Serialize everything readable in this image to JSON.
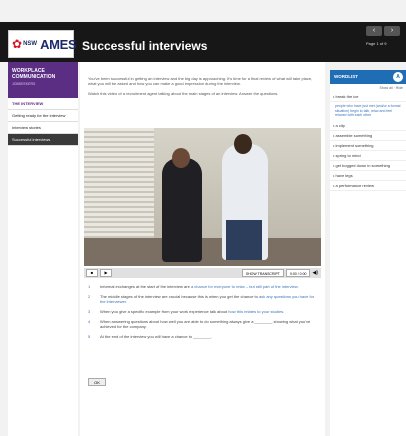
{
  "header": {
    "logo_nsw": "NSW",
    "logo_ames": "AMES",
    "title": "Successful interviews",
    "prev": "‹",
    "next": "›",
    "page_indicator": "Page 1 of 9"
  },
  "leftnav": {
    "heading": "WORKPLACE COMMUNICATION",
    "subheading": "JOBSEEKERS",
    "section": "THE INTERVIEW",
    "items": [
      {
        "label": "Getting ready for the interview"
      },
      {
        "label": "Interview stories"
      },
      {
        "label": "Successful interviews"
      }
    ]
  },
  "intro": {
    "p1": "You've been successful in getting an interview and the big day is approaching. It's time for a final review of what will take place, what you will be asked and how you can make a good impression during the interview.",
    "p2": "Watch this video of a recruitment agent talking about the main stages of an interview. Answer the questions."
  },
  "controls": {
    "play": "▶",
    "stop": "■",
    "show_transcript": "SHOW TRANSCRIPT",
    "time": "0:00 / 0:00",
    "volume": "◀)"
  },
  "questions": [
    {
      "num": "1",
      "text": "Informal exchanges at the start of the interview are ",
      "blue": "a chance for everyone to relax – but still part of the interview."
    },
    {
      "num": "2",
      "text": "The middle stages of the interview are crucial because this is when you get the chance to ",
      "blue": "ask any questions you have for the interviewer."
    },
    {
      "num": "3",
      "text": "When you give a specific example from your work experience talk about ",
      "blue": "how this relates to your studies."
    },
    {
      "num": "4",
      "text": "When answering questions about how well you are able to do something always give a ________ showing what you've achieved for the company.",
      "blue": ""
    },
    {
      "num": "5",
      "text": "At the end of the interview you will have a chance to ________.",
      "blue": ""
    }
  ],
  "ok_label": "OK",
  "wordlist": {
    "heading": "WORDLIST",
    "badge": "A",
    "show_all": "Show all · Hide",
    "items": [
      {
        "term": "• break the ice",
        "def": "people who have just met (and/or a formal situation) begin to talk, relax and feel relaxed with each other"
      },
      {
        "term": "• a clip",
        "def": ""
      },
      {
        "term": "• assemble something",
        "def": ""
      },
      {
        "term": "• implement something",
        "def": ""
      },
      {
        "term": "• spring to mind",
        "def": ""
      },
      {
        "term": "• get bogged down in something",
        "def": ""
      },
      {
        "term": "• have legs",
        "def": ""
      },
      {
        "term": "• a performance review",
        "def": ""
      }
    ]
  }
}
